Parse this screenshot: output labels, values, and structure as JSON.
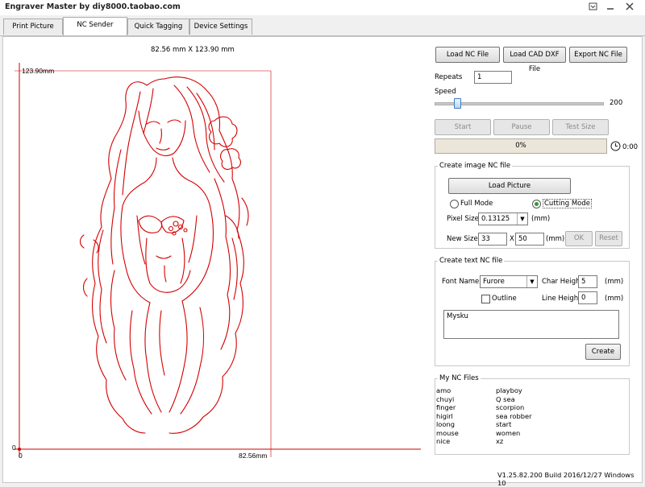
{
  "window": {
    "title": "Engraver Master by diy8000.taobao.com"
  },
  "tabs": [
    "Print Picture",
    "NC Sender",
    "Quick Tagging",
    "Device Settings"
  ],
  "preview": {
    "dims_label": "82.56 mm X 123.90 mm",
    "y_max_label": "123.90mm",
    "y_zero_label": "0",
    "x_zero_label": "0",
    "x_max_label": "82.56mm",
    "axis_color": "#cc0000",
    "drawing_color": "#d40000"
  },
  "file_buttons": {
    "load_nc": "Load NC File",
    "load_cad": "Load CAD DXF File",
    "export_nc": "Export NC File"
  },
  "repeats": {
    "label": "Repeats",
    "value": "1"
  },
  "speed": {
    "label": "Speed",
    "value": "200",
    "fraction": 0.02
  },
  "controls": {
    "start": "Start",
    "pause": "Pause",
    "test_size": "Test Size"
  },
  "progress": {
    "value": "0%",
    "time": "0:00"
  },
  "image_nc": {
    "legend": "Create image NC file",
    "load_picture": "Load Picture",
    "full_mode": "Full Mode",
    "cutting_mode": "Cutting Mode",
    "pixel_size_label": "Pixel Size",
    "pixel_size_value": "0.13125",
    "mm1": "(mm)",
    "new_size_label": "New Size",
    "new_w": "33",
    "x_label": "X",
    "new_h": "50",
    "mm2": "(mm)",
    "ok": "OK",
    "reset": "Reset"
  },
  "text_nc": {
    "legend": "Create text NC file",
    "font_name_label": "Font Name",
    "font_value": "Furore",
    "char_height_label": "Char Height",
    "char_height_value": "5",
    "mm1": "(mm)",
    "outline_label": "Outline",
    "line_height_label": "Line Height",
    "line_height_value": "0",
    "mm2": "(mm)",
    "text_value": "Mysku",
    "create": "Create"
  },
  "my_files": {
    "legend": "My NC Files",
    "col1": [
      "amo",
      "chuyi",
      "finger",
      "higirl",
      "loong",
      "mouse",
      "nice"
    ],
    "col2": [
      "playboy",
      "Q sea",
      "scorpion",
      "sea robber",
      "start",
      "women",
      "xz"
    ]
  },
  "version": "V1.25.82.200 Build 2016/12/27 Windows 10"
}
